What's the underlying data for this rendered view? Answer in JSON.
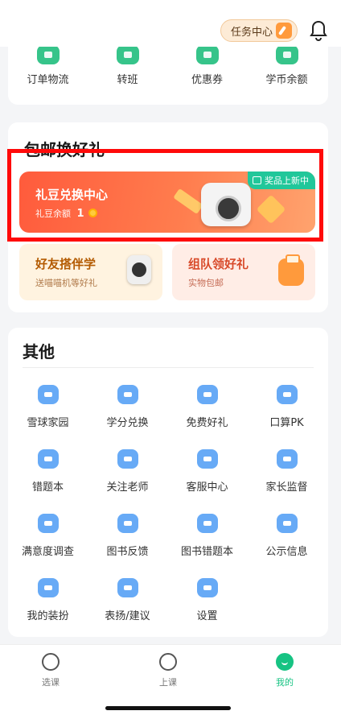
{
  "header": {
    "task_center_label": "任务中心",
    "bell_icon": "bell-icon"
  },
  "orders": {
    "items": [
      {
        "label": "订单物流",
        "icon": "order-logistics-icon"
      },
      {
        "label": "转班",
        "icon": "transfer-class-icon"
      },
      {
        "label": "优惠券",
        "icon": "coupon-icon"
      },
      {
        "label": "学币余额",
        "icon": "coin-balance-icon"
      }
    ]
  },
  "free_shipping": {
    "title": "包邮换好礼",
    "banner": {
      "title": "礼豆兑换中心",
      "balance_label": "礼豆余额",
      "balance_value": "1",
      "badge": "奖品上新中"
    },
    "tiles": [
      {
        "title": "好友搭伴学",
        "subtitle": "送喵喵机等好礼"
      },
      {
        "title": "组队领好礼",
        "subtitle": "实物包邮"
      }
    ]
  },
  "other": {
    "title": "其他",
    "items": [
      {
        "label": "雪球家园",
        "icon": "snowball-home-icon"
      },
      {
        "label": "学分兑换",
        "icon": "credit-exchange-icon"
      },
      {
        "label": "免费好礼",
        "icon": "free-gift-icon"
      },
      {
        "label": "口算PK",
        "icon": "math-pk-icon"
      },
      {
        "label": "错题本",
        "icon": "wrong-questions-icon"
      },
      {
        "label": "关注老师",
        "icon": "follow-teacher-icon"
      },
      {
        "label": "客服中心",
        "icon": "customer-service-icon"
      },
      {
        "label": "家长监督",
        "icon": "parent-supervision-icon"
      },
      {
        "label": "满意度调查",
        "icon": "survey-icon"
      },
      {
        "label": "图书反馈",
        "icon": "book-feedback-icon"
      },
      {
        "label": "图书错题本",
        "icon": "book-wrong-questions-icon"
      },
      {
        "label": "公示信息",
        "icon": "notice-icon"
      },
      {
        "label": "我的装扮",
        "icon": "my-outfit-icon"
      },
      {
        "label": "表扬/建议",
        "icon": "praise-suggest-icon"
      },
      {
        "label": "设置",
        "icon": "settings-icon"
      }
    ]
  },
  "tabbar": {
    "tabs": [
      {
        "label": "选课",
        "icon": "select-course-icon"
      },
      {
        "label": "上课",
        "icon": "attend-class-icon"
      },
      {
        "label": "我的",
        "icon": "profile-icon"
      }
    ],
    "active": "我的"
  },
  "colors": {
    "accent": "#17c383",
    "banner": "#ff6a45",
    "badge": "#21c79a",
    "highlight": "#ff0a0a"
  }
}
